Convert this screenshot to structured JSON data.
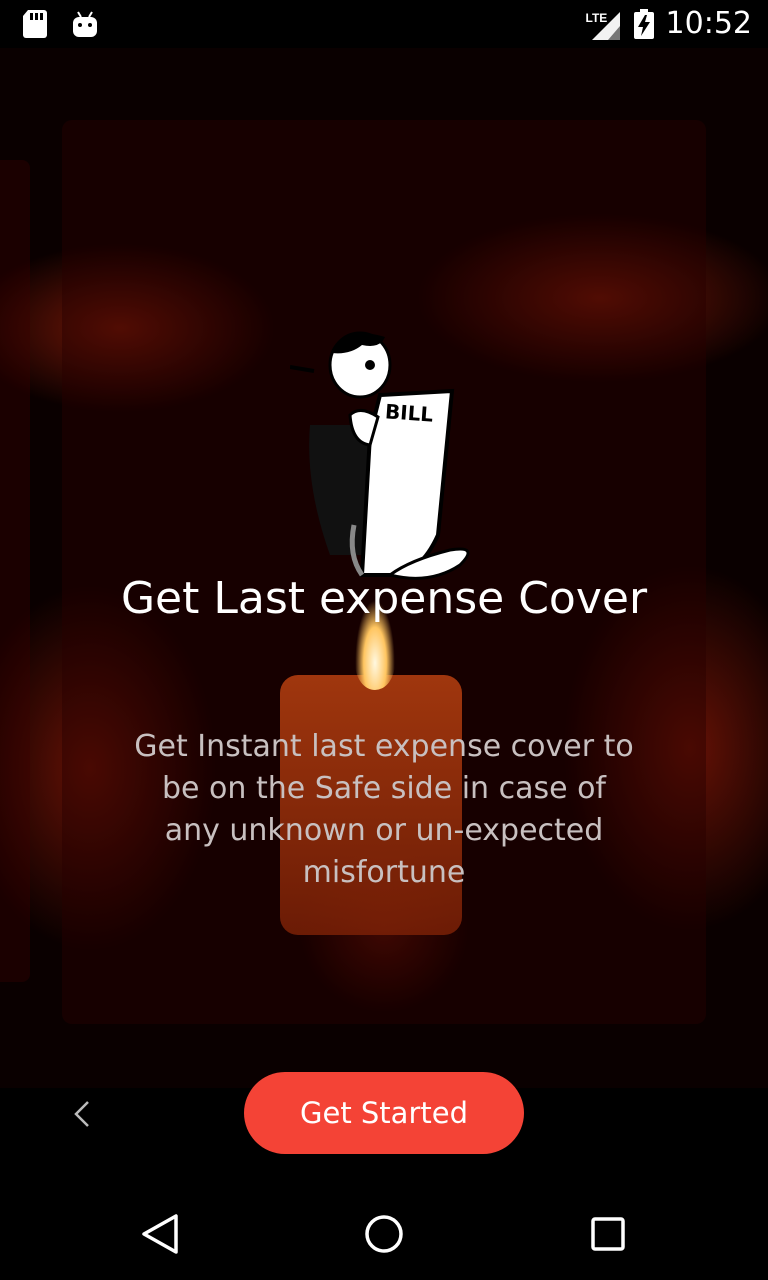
{
  "status_bar": {
    "time": "10:52",
    "network": "LTE",
    "left_icons": [
      "sd-card-icon",
      "android-icon"
    ],
    "right_icons": [
      "signal-icon",
      "battery-charging-icon"
    ]
  },
  "onboarding": {
    "title": "Get Last expense Cover",
    "description": "Get Instant last expense cover to be on the Safe side in case of any unknown or un-expected misfortune",
    "illustration_text": "BILL",
    "back_icon": "chevron-left-icon",
    "get_started_label": "Get Started"
  },
  "nav_bar": {
    "buttons": [
      "back-triangle-icon",
      "home-circle-icon",
      "recents-square-icon"
    ]
  },
  "colors": {
    "accent": "#f44336",
    "background": "#000000"
  }
}
